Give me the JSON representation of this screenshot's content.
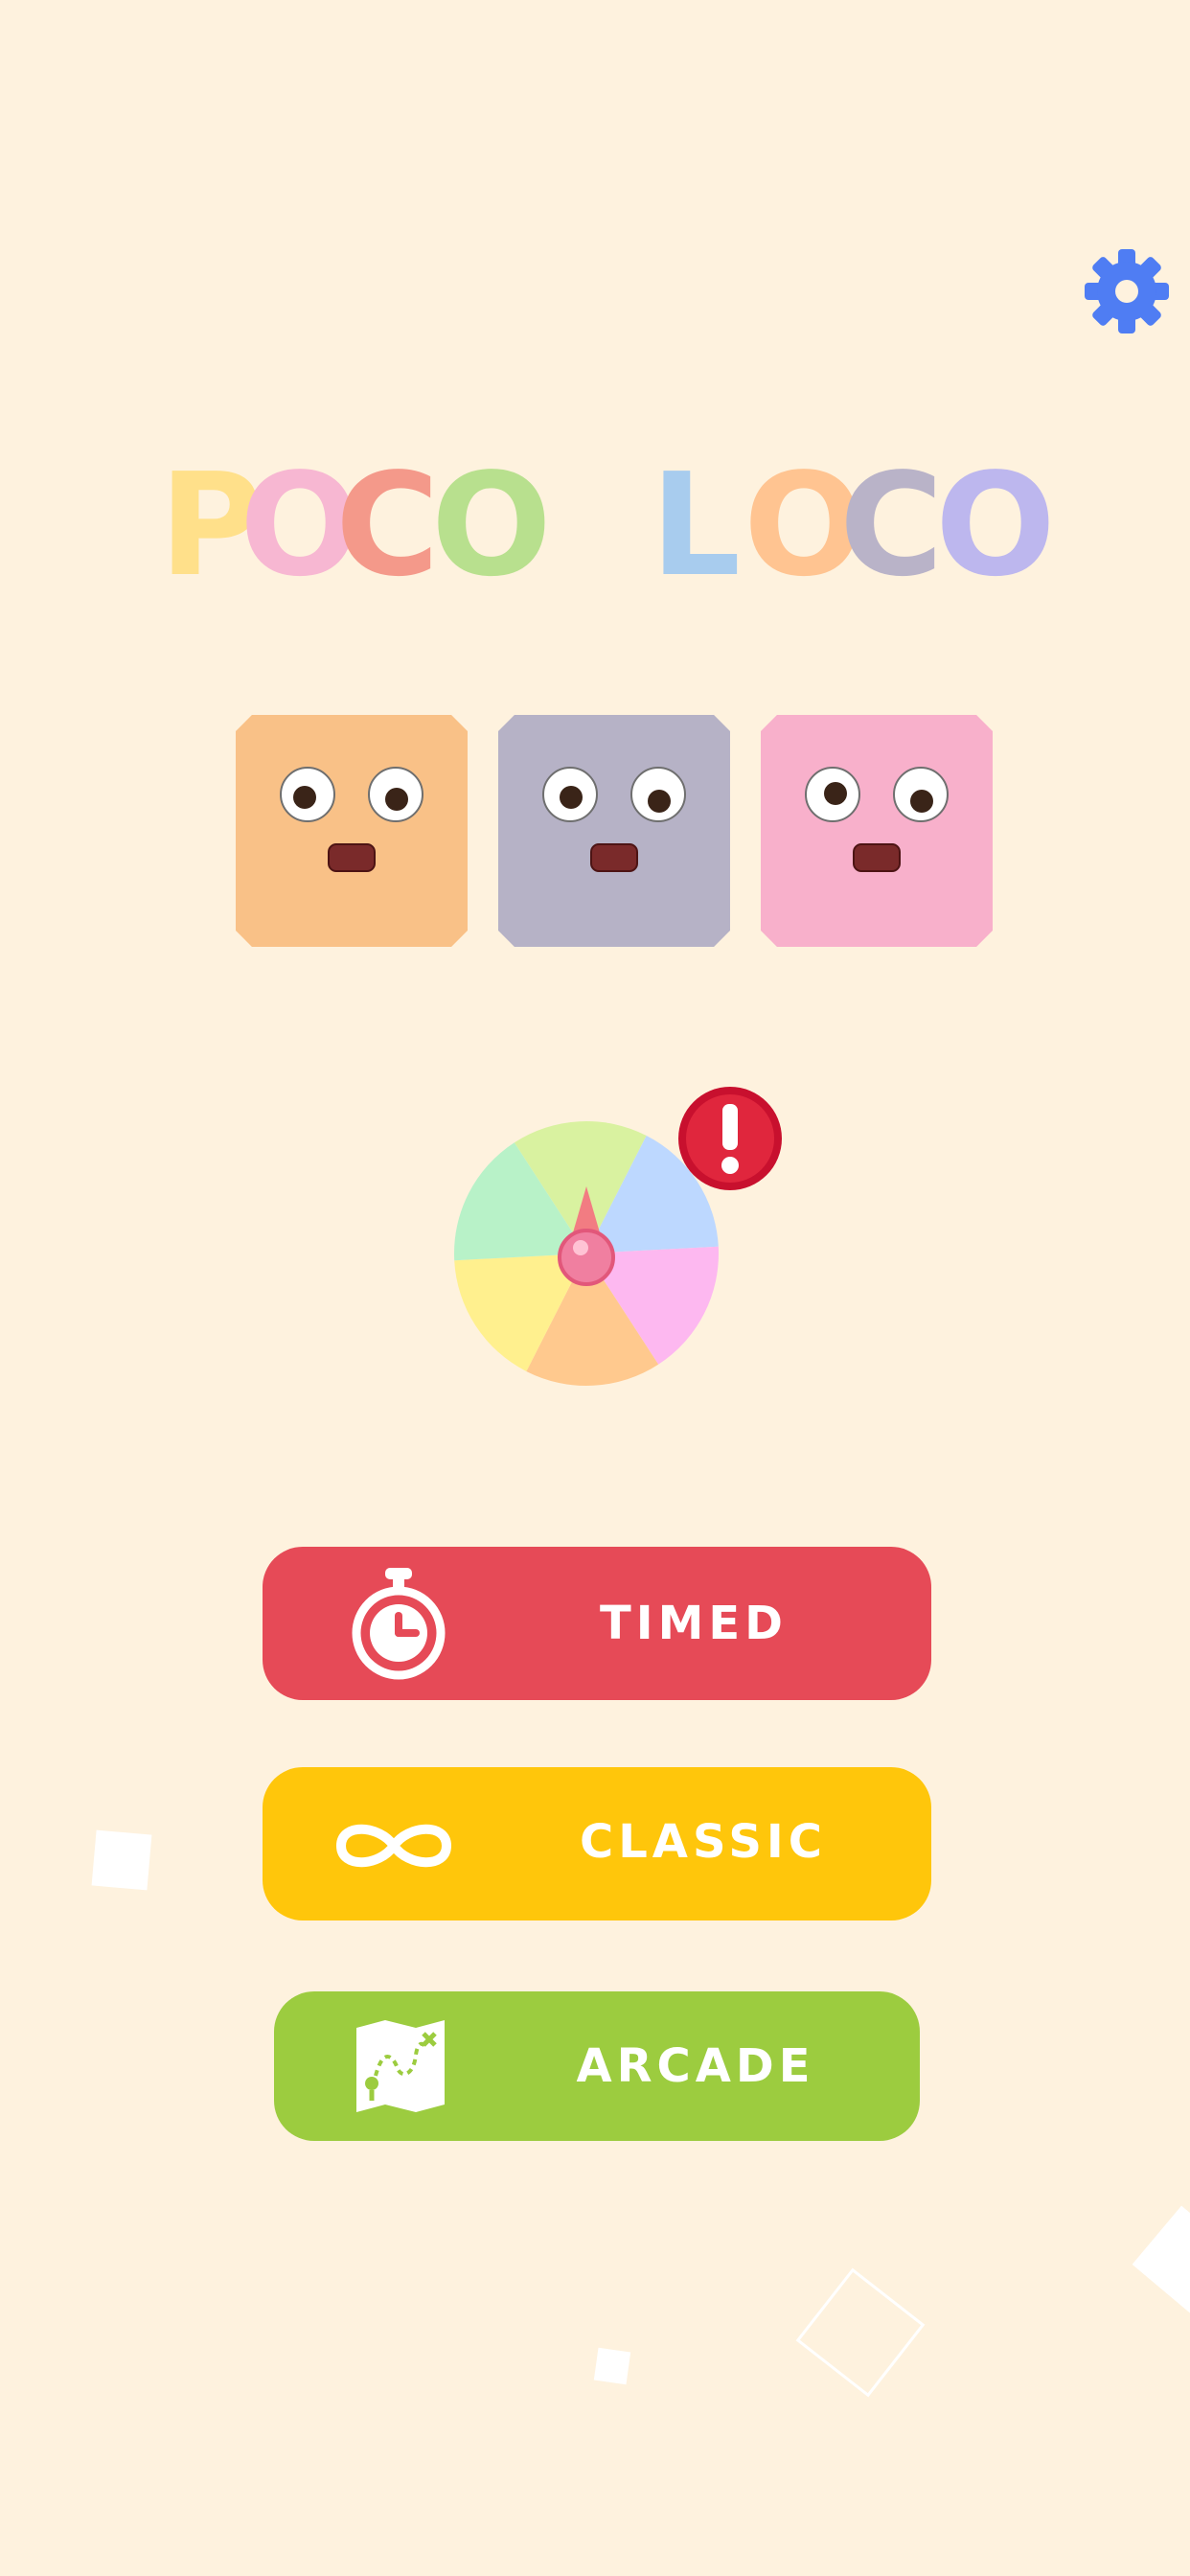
{
  "title": {
    "word1": [
      "P",
      "O",
      "C",
      "O"
    ],
    "word2": [
      "L",
      "O",
      "C",
      "O"
    ],
    "word1_colors": [
      "#FFE08A",
      "#F7B7D2",
      "#F4998A",
      "#B8E08E"
    ],
    "word2_colors": [
      "#A8CCEE",
      "#FFC491",
      "#B9B3C8",
      "#BDB7EE"
    ]
  },
  "characters": [
    {
      "color": "#F9C187"
    },
    {
      "color": "#B6B2C6"
    },
    {
      "color": "#F8B0CB"
    }
  ],
  "wheel": {
    "segment_colors": [
      "#D9F2A0",
      "#BDD8FF",
      "#FDB8F0",
      "#FFC98E",
      "#FFF08E",
      "#B8F2C8"
    ],
    "alert_symbol": "!"
  },
  "buttons": {
    "timed": {
      "label": "TIMED",
      "color": "#E64A57",
      "icon": "stopwatch-icon"
    },
    "classic": {
      "label": "CLASSIC",
      "color": "#FFC60B",
      "icon": "infinity-icon"
    },
    "arcade": {
      "label": "ARCADE",
      "color": "#9CCC3F",
      "icon": "treasure-map-icon"
    }
  },
  "settings": {
    "icon": "gear-icon",
    "color": "#4F7DF3"
  }
}
